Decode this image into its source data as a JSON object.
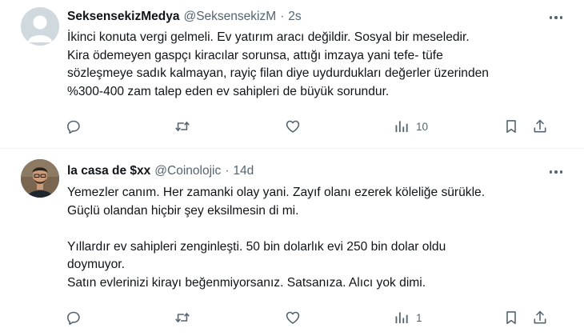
{
  "tweets": [
    {
      "display_name": "SeksensekizMedya",
      "handle": "@SeksensekizM",
      "time": "2s",
      "lines": [
        "İkinci konuta vergi gelmeli. Ev yatırım aracı değildir. Sosyal bir meseledir.",
        "Kira ödemeyen gaspçı kiracılar sorunsa, attığı imzaya yani tefe- tüfe",
        "sözleşmeye sadık kalmayan, rayiç filan diye uydurdukları değerler üzerinden",
        "%300-400 zam talep eden ev sahipleri de büyük sorundur."
      ],
      "views": "10",
      "avatar_icon": "default-profile-icon"
    },
    {
      "display_name": "la casa de $xx",
      "handle": "@Coinolojic",
      "time": "14d",
      "lines": [
        "Yemezler canım. Her zamanki olay yani. Zayıf olanı ezerek köleliğe sürükle.",
        "Güçlü olandan hiçbir şey eksilmesin di mi.",
        "",
        "Yıllardır ev sahipleri zenginleşti. 50 bin dolarlık evi 250 bin dolar oldu",
        "doymuyor.",
        "Satın evlerinizi kirayı beğenmiyorsanız. Satsanıza. Alıcı yok dimi."
      ],
      "views": "1",
      "avatar_icon": "profile-photo"
    }
  ],
  "icons": [
    "reply-icon",
    "retweet-icon",
    "like-icon",
    "views-icon",
    "bookmark-icon",
    "share-icon",
    "more-icon"
  ],
  "colors": {
    "text": "#0f1419",
    "secondary": "#536471",
    "divider": "#eff3f4",
    "default_avatar": "#cfd9de"
  }
}
